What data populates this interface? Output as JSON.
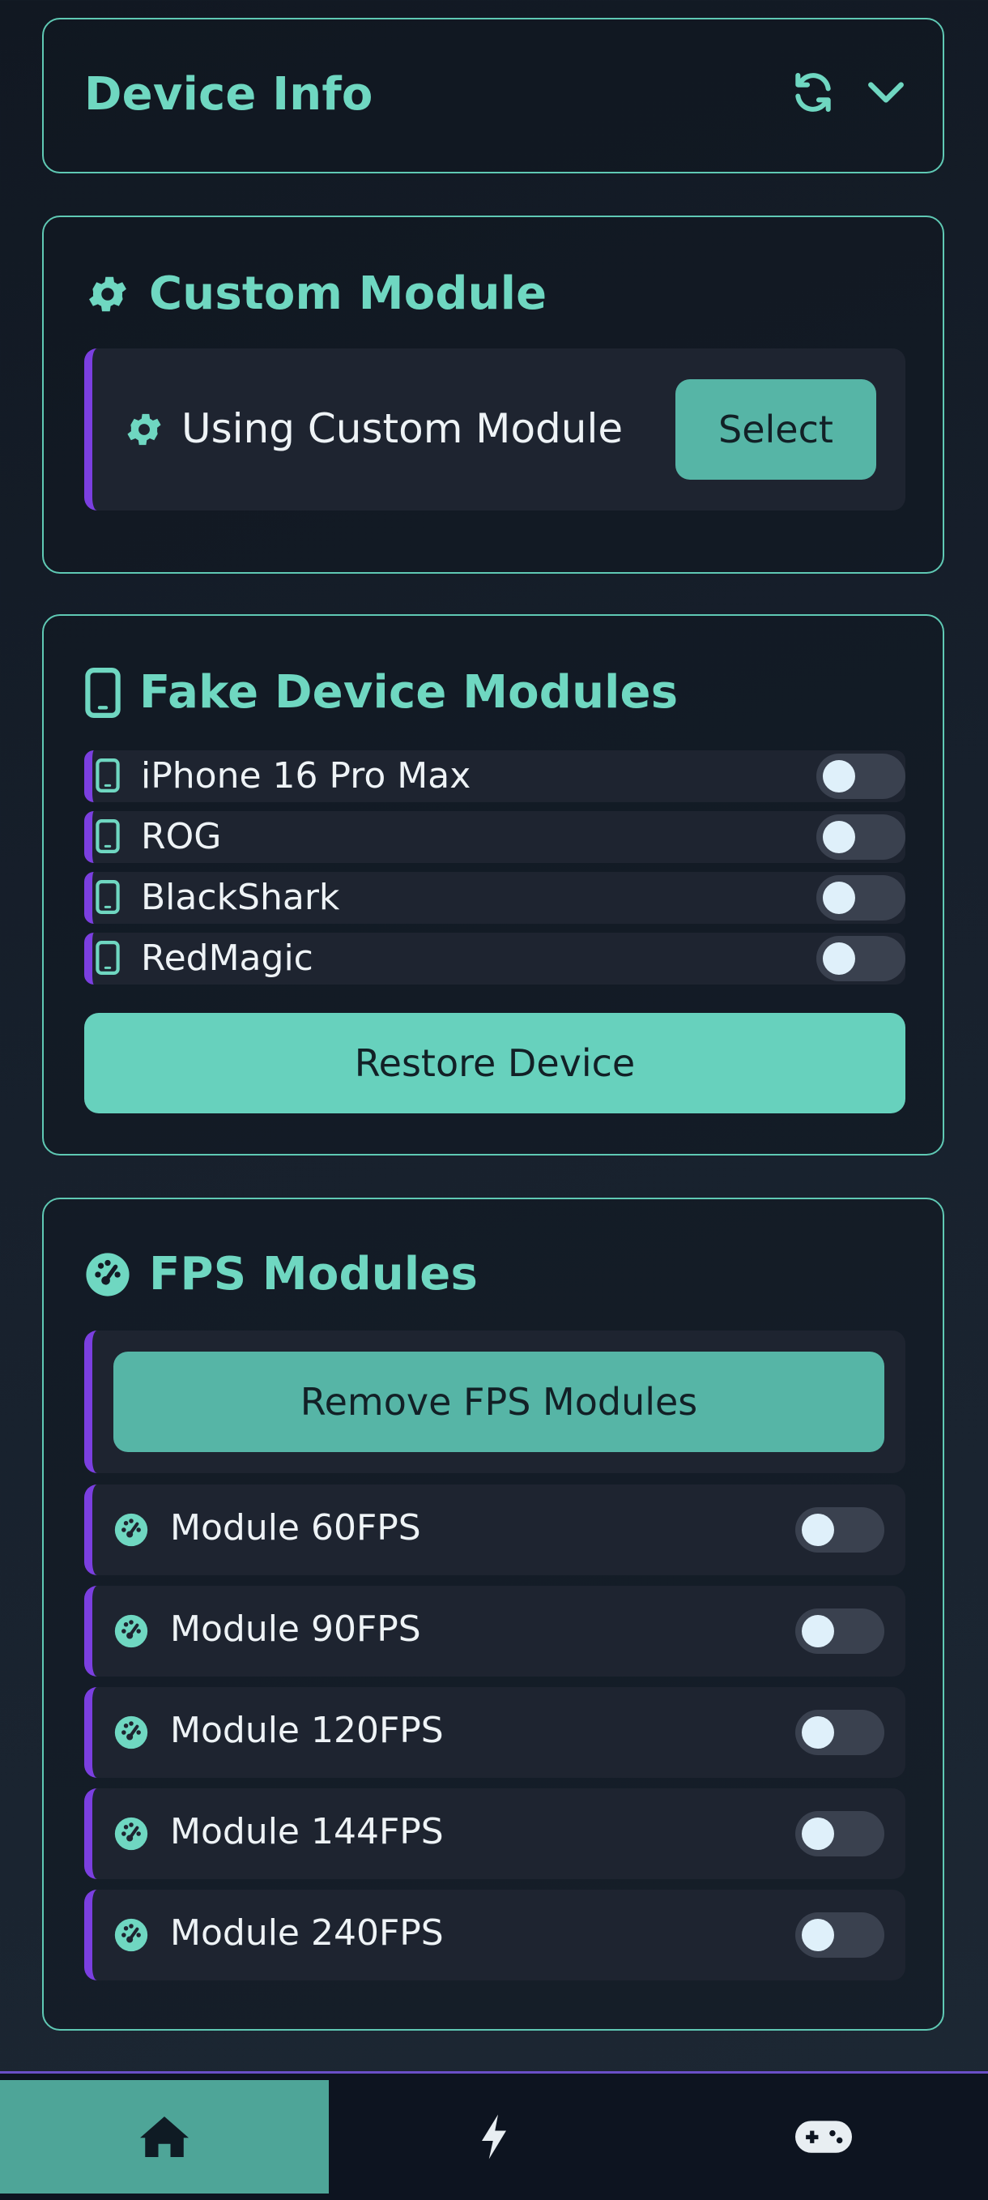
{
  "device_info": {
    "title": "Device Info",
    "refresh_icon": "refresh-icon",
    "expand_icon": "chevron-down-icon"
  },
  "custom_module": {
    "title": "Custom Module",
    "icon": "gear-icon",
    "status_label": "Using Custom Module",
    "select_label": "Select"
  },
  "fake_device": {
    "title": "Fake Device Modules",
    "icon": "phone-icon",
    "items": [
      {
        "label": "iPhone 16 Pro Max",
        "enabled": false
      },
      {
        "label": "ROG",
        "enabled": false
      },
      {
        "label": "BlackShark",
        "enabled": false
      },
      {
        "label": "RedMagic",
        "enabled": false
      }
    ],
    "restore_label": "Restore Device"
  },
  "fps": {
    "title": "FPS Modules",
    "icon": "speedometer-icon",
    "remove_label": "Remove FPS Modules",
    "items": [
      {
        "label": "Module 60FPS",
        "enabled": false
      },
      {
        "label": "Module 90FPS",
        "enabled": false
      },
      {
        "label": "Module 120FPS",
        "enabled": false
      },
      {
        "label": "Module 144FPS",
        "enabled": false
      },
      {
        "label": "Module 240FPS",
        "enabled": false
      }
    ]
  },
  "nav": {
    "active": "home",
    "items": [
      {
        "id": "home",
        "icon": "home-icon"
      },
      {
        "id": "boost",
        "icon": "lightning-icon"
      },
      {
        "id": "games",
        "icon": "gamepad-icon"
      }
    ]
  },
  "colors": {
    "accent": "#6fd7c1",
    "button": "#56b5a6",
    "stripe": "#7b3fe0",
    "nav_active": "#4ea598"
  }
}
